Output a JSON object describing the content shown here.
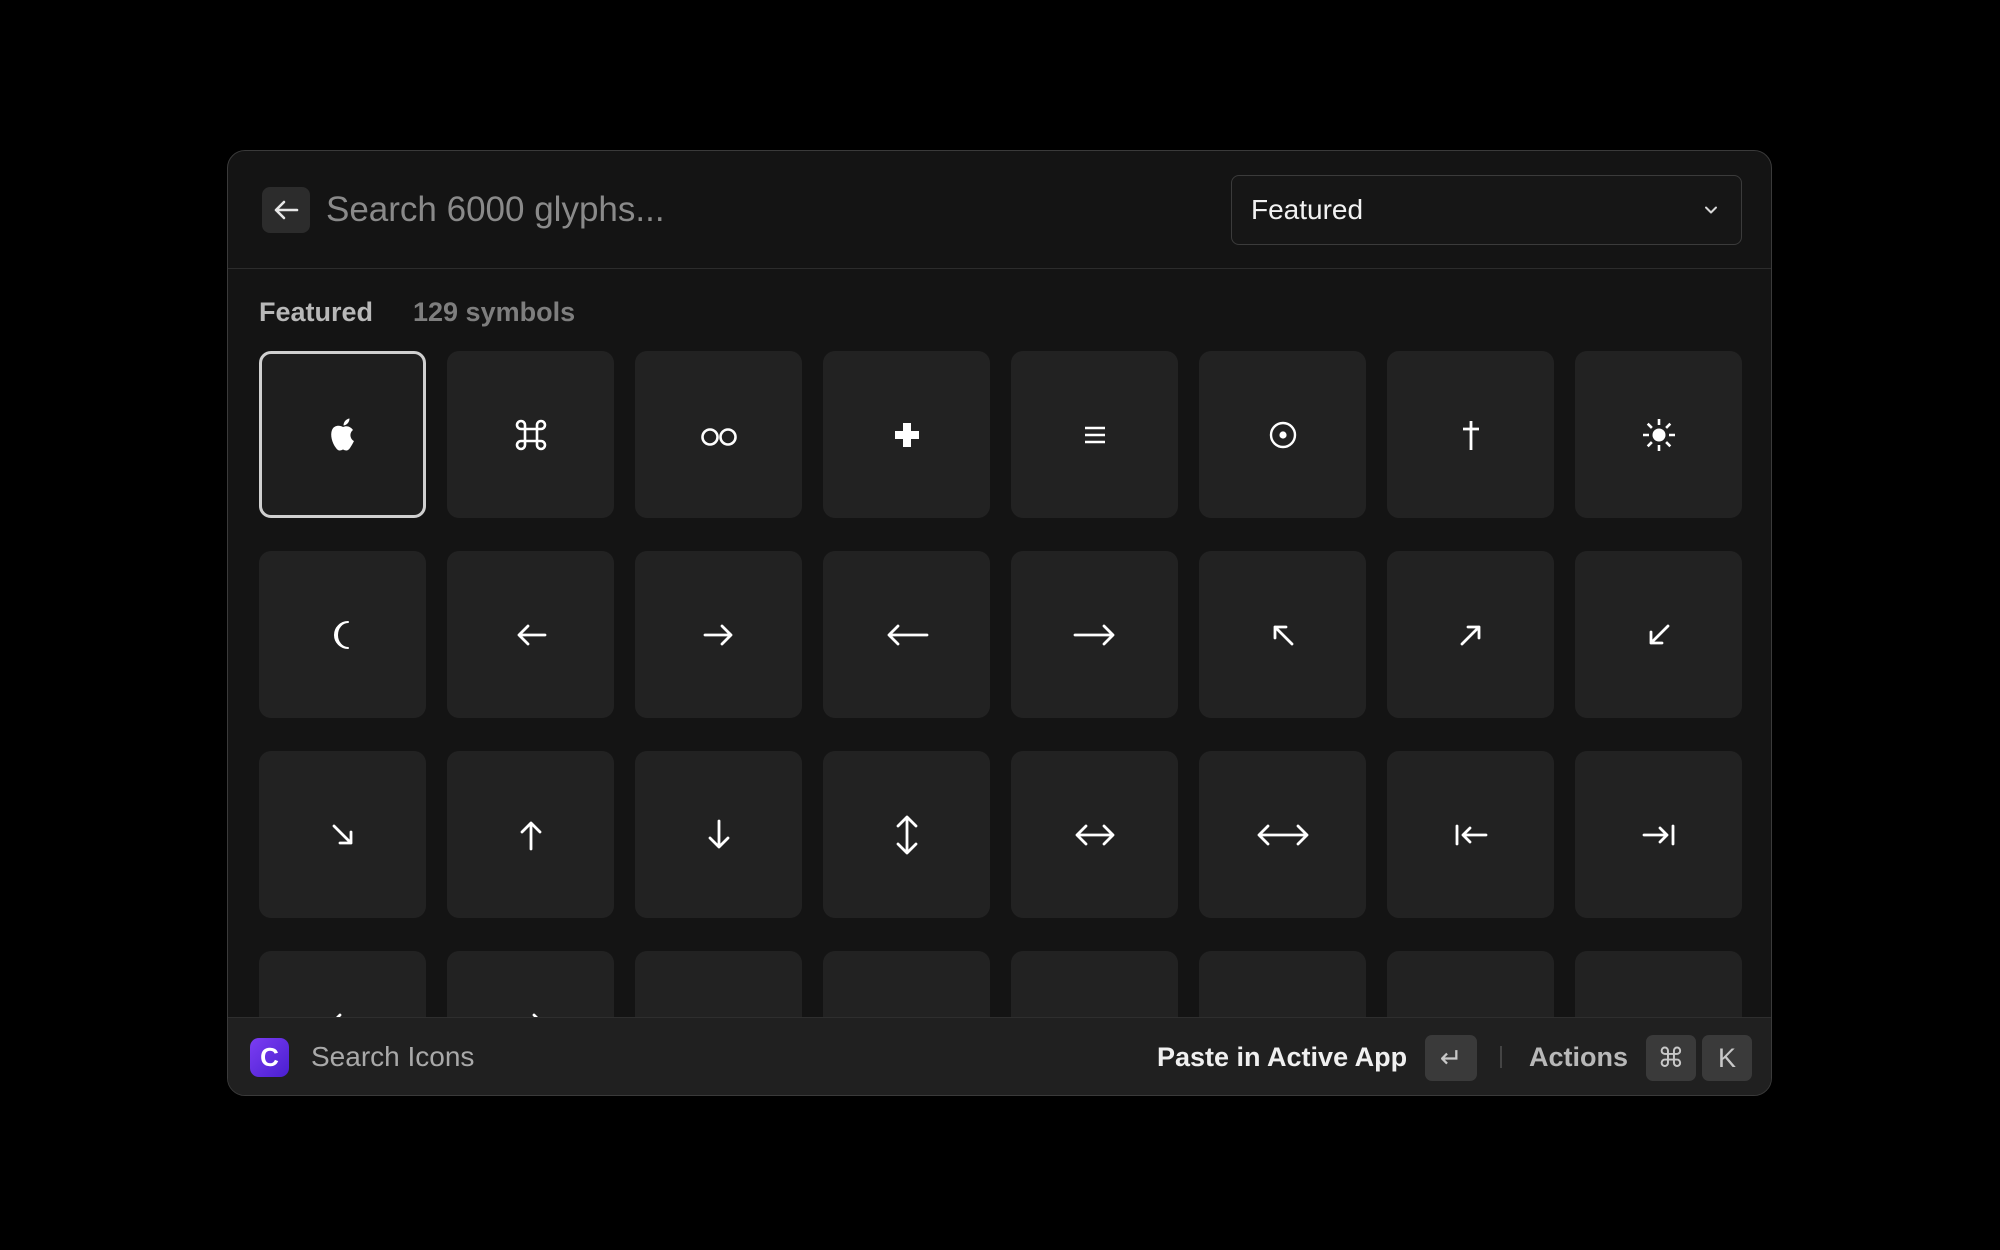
{
  "search": {
    "placeholder": "Search 6000 glyphs..."
  },
  "filter": {
    "selected": "Featured"
  },
  "section": {
    "title": "Featured",
    "count": "129 symbols"
  },
  "symbols": [
    {
      "name": "apple-logo-icon"
    },
    {
      "name": "command-icon"
    },
    {
      "name": "infinity-loop-icon"
    },
    {
      "name": "heavy-plus-icon"
    },
    {
      "name": "triple-bar-icon"
    },
    {
      "name": "circled-dot-icon"
    },
    {
      "name": "dagger-icon"
    },
    {
      "name": "sun-icon"
    },
    {
      "name": "crescent-moon-icon"
    },
    {
      "name": "arrow-left-icon"
    },
    {
      "name": "arrow-right-icon"
    },
    {
      "name": "long-arrow-left-icon"
    },
    {
      "name": "long-arrow-right-icon"
    },
    {
      "name": "arrow-up-left-icon"
    },
    {
      "name": "arrow-up-right-icon"
    },
    {
      "name": "arrow-down-left-icon"
    },
    {
      "name": "arrow-down-right-icon"
    },
    {
      "name": "arrow-up-icon"
    },
    {
      "name": "arrow-down-icon"
    },
    {
      "name": "arrow-up-down-icon"
    },
    {
      "name": "arrow-left-right-icon"
    },
    {
      "name": "long-arrow-left-right-icon"
    },
    {
      "name": "arrow-left-to-bar-icon"
    },
    {
      "name": "arrow-right-to-bar-icon"
    },
    {
      "name": "partial-glyph-icon"
    },
    {
      "name": "partial-glyph-icon"
    },
    {
      "name": "partial-glyph-icon"
    },
    {
      "name": "partial-glyph-icon"
    },
    {
      "name": "partial-glyph-icon"
    },
    {
      "name": "partial-glyph-icon"
    },
    {
      "name": "partial-glyph-icon"
    },
    {
      "name": "partial-glyph-icon"
    }
  ],
  "footer": {
    "app_initial": "C",
    "app_name": "Search Icons",
    "primary_action": "Paste in Active App",
    "enter_key": "↵",
    "actions_label": "Actions",
    "cmd_key": "⌘",
    "k_key": "K"
  },
  "colors": {
    "accent": "#6a30e8",
    "background": "#141414",
    "tile": "#222222"
  }
}
